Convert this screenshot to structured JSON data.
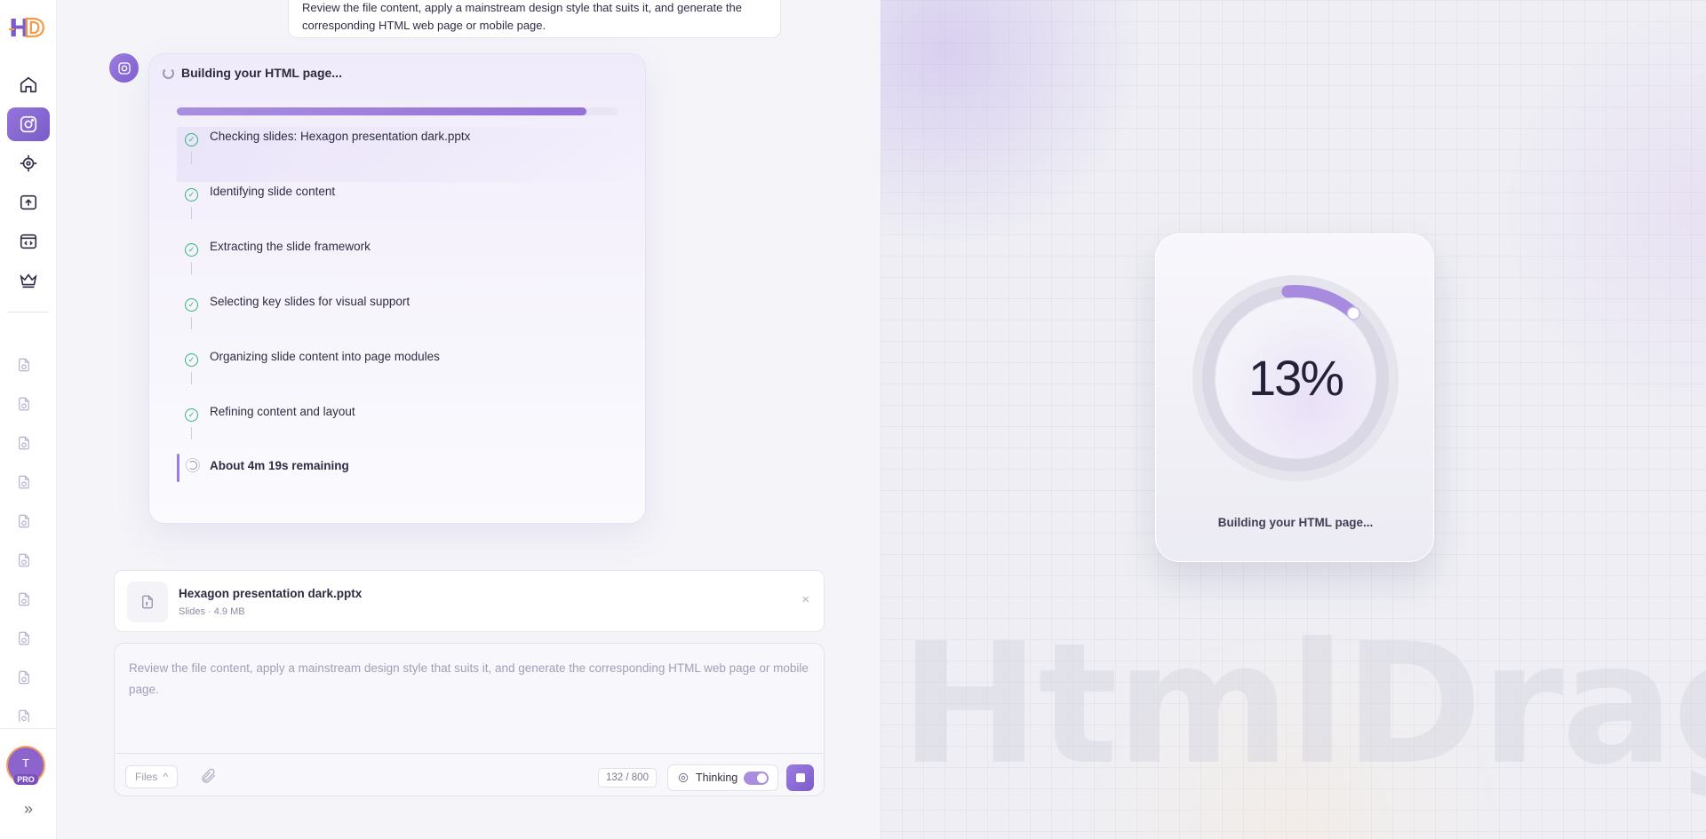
{
  "sidebar": {
    "logo": "HD",
    "nav": [
      {
        "id": "home",
        "icon": "home-icon"
      },
      {
        "id": "generate",
        "icon": "camera-icon",
        "active": true
      },
      {
        "id": "target",
        "icon": "crosshair-icon"
      },
      {
        "id": "upload",
        "icon": "upload-icon"
      },
      {
        "id": "code",
        "icon": "code-window-icon"
      },
      {
        "id": "premium",
        "icon": "crown-icon"
      }
    ],
    "history_icon": "file-history-icon",
    "user": {
      "initial": "T",
      "badge": "PRO"
    },
    "expand_icon": "»"
  },
  "chat": {
    "user_message": "Review the file content, apply a mainstream design style that suits it, and generate the corresponding HTML web page or mobile page.",
    "progress_card": {
      "title": "Building your HTML page...",
      "progress": 0.93,
      "steps": [
        {
          "label": "Checking slides: Hexagon presentation dark.pptx",
          "status": "done"
        },
        {
          "label": "Identifying slide content",
          "status": "done"
        },
        {
          "label": "Extracting the slide framework",
          "status": "done"
        },
        {
          "label": "Selecting key slides for visual support",
          "status": "done"
        },
        {
          "label": "Organizing slide content into page modules",
          "status": "done"
        },
        {
          "label": "Refining content and layout",
          "status": "done"
        }
      ],
      "current": "About 4m 19s remaining"
    },
    "attachment": {
      "name": "Hexagon presentation dark.pptx",
      "meta": "Slides · 4.9 MB",
      "close": "×"
    },
    "composer": {
      "text": "Review the file content, apply a mainstream design style that suits it, and generate the corresponding HTML web page or mobile page.",
      "files_label": "Files",
      "files_caret": "^",
      "counter": "132 / 800",
      "thinking_label": "Thinking",
      "thinking_on": true
    }
  },
  "preview": {
    "watermark": "HtmlDrag",
    "percent_label": "13%",
    "percent_value": 13,
    "status": "Building your HTML page...",
    "colors": {
      "accent": "#9f85dc",
      "ring_track": "#dcdbe7"
    }
  }
}
